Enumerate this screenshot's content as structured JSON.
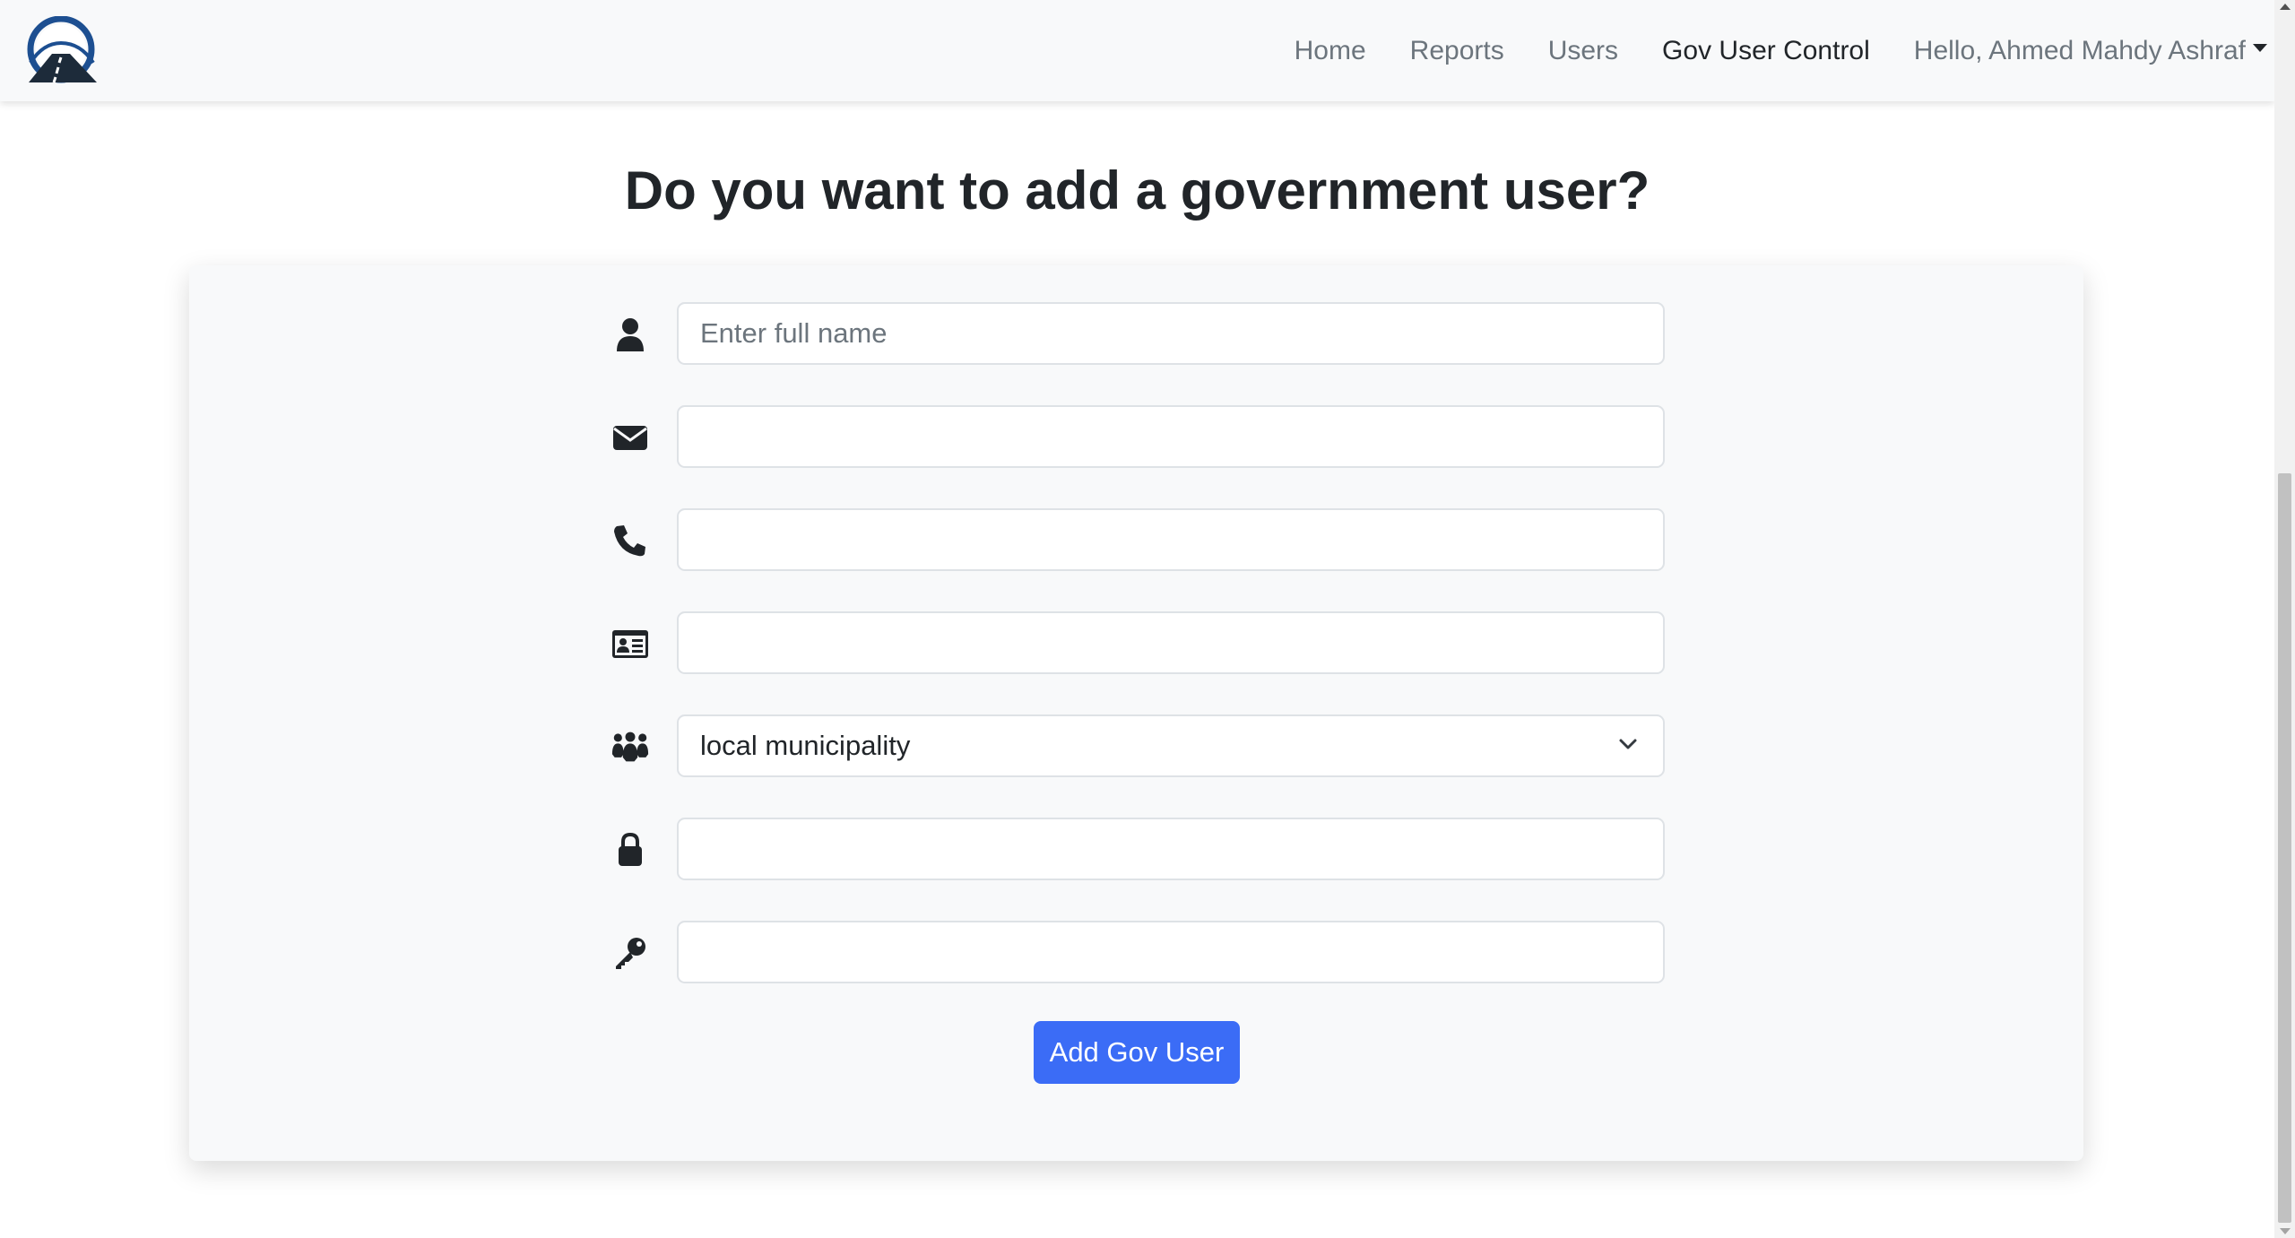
{
  "navbar": {
    "logo_icon": "road-tunnel-logo",
    "links": [
      {
        "label": "Home"
      },
      {
        "label": "Reports"
      },
      {
        "label": "Users"
      },
      {
        "label": "Gov User Control"
      }
    ],
    "user_greeting": "Hello, Ahmed Mahdy Ashraf"
  },
  "page": {
    "title": "Do you want to add a government user?"
  },
  "form": {
    "full_name": {
      "icon": "user-icon",
      "placeholder": "Enter full name",
      "value": ""
    },
    "email": {
      "icon": "envelope-icon",
      "value": ""
    },
    "phone": {
      "icon": "phone-icon",
      "value": ""
    },
    "id_card": {
      "icon": "id-card-icon",
      "value": ""
    },
    "organization": {
      "icon": "people-group-icon",
      "selected": "local municipality"
    },
    "password": {
      "icon": "lock-icon",
      "value": ""
    },
    "confirm_password": {
      "icon": "key-icon",
      "value": ""
    },
    "submit_label": "Add Gov User"
  },
  "colors": {
    "primary": "#3b6cf6",
    "navbar_bg": "#f8f9fa",
    "card_bg": "#f8f9fa",
    "logo_blue": "#1d4f91",
    "text": "#212529",
    "muted": "#6c757d"
  }
}
